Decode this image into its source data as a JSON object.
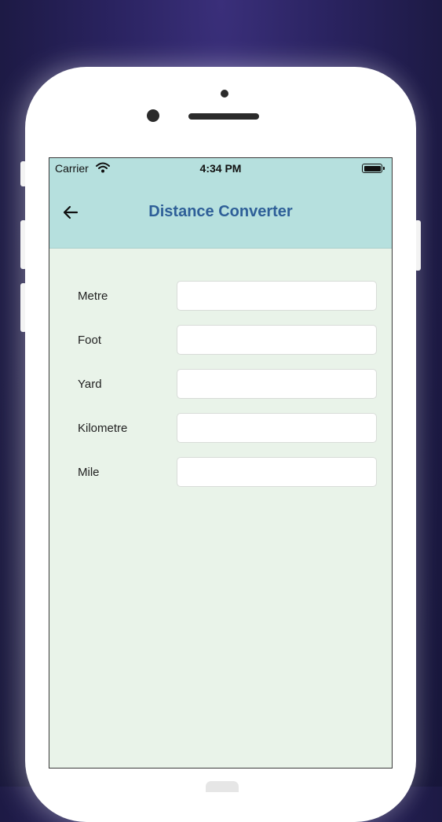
{
  "status_bar": {
    "carrier": "Carrier",
    "time": "4:34 PM"
  },
  "app_bar": {
    "title": "Distance Converter",
    "back_icon": "arrow-left-icon"
  },
  "fields": [
    {
      "label": "Metre",
      "value": "",
      "placeholder": ""
    },
    {
      "label": "Foot",
      "value": "",
      "placeholder": ""
    },
    {
      "label": "Yard",
      "value": "",
      "placeholder": ""
    },
    {
      "label": "Kilometre",
      "value": "",
      "placeholder": ""
    },
    {
      "label": "Mile",
      "value": "",
      "placeholder": ""
    }
  ],
  "colors": {
    "app_bar": "#b6e0de",
    "title": "#2e5f98",
    "screen_bg": "#e9f3e9",
    "background": "#1d1a45"
  }
}
